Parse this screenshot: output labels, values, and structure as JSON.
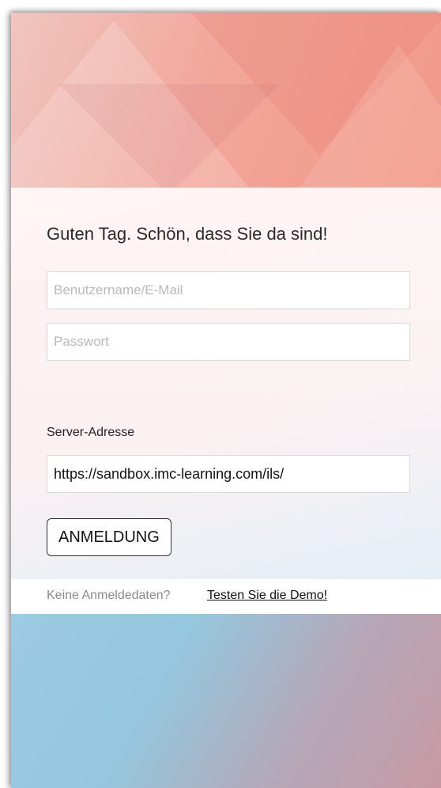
{
  "login": {
    "greeting": "Guten Tag. Schön, dass Sie da sind!",
    "username_placeholder": "Benutzername/E-Mail",
    "password_placeholder": "Passwort",
    "server_label": "Server-Adresse",
    "server_value": "https://sandbox.imc-learning.com/ils/",
    "submit_label": "ANMELDUNG"
  },
  "demo": {
    "prompt": "Keine Anmeldedaten?",
    "link": "Testen Sie die Demo!"
  },
  "colors": {
    "hero_coral": "#f29887",
    "bottom_blue": "#95c7de",
    "placeholder_gray": "#b9b9b9"
  }
}
